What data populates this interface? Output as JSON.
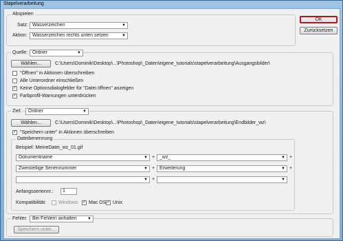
{
  "window": {
    "title": "Stapelverarbeitung"
  },
  "buttons": {
    "ok": "OK",
    "reset": "Zurücksetzen"
  },
  "abspielen": {
    "legend": "Abspielen",
    "satz_label": "Satz:",
    "satz_value": "Wasserzeichen",
    "aktion_label": "Aktion:",
    "aktion_value": "Wasserzeichen rechts unten setzen"
  },
  "quelle": {
    "label": "Quelle:",
    "value": "Ordner",
    "choose": "Wählen...",
    "path": "C:\\Users\\Dominik\\Desktop\\...\\Photoshop\\_Daten\\eigene_tutorials\\stapelverarbeitung\\Ausgangsbilder\\",
    "options": [
      {
        "label": "\"Öffnen\" in Aktionen überschreiben",
        "checked": false
      },
      {
        "label": "Alle Unterordner einschließen",
        "checked": false
      },
      {
        "label": "Keine Optionsdialogfelder für \"Datei öffnen\" anzeigen",
        "checked": true
      },
      {
        "label": "Farbprofil-Warnungen unterdrücken",
        "checked": true
      }
    ]
  },
  "ziel": {
    "label": "Ziel:",
    "value": "Ordner",
    "choose": "Wählen...",
    "path": "C:\\Users\\Dominik\\Desktop\\...\\Photoshop\\_Daten\\eigene_tutorials\\stapelverarbeitung\\Endbilder_wz\\",
    "override_label": "\"Speichern unter\" in Aktionen überschreiben",
    "override_checked": true,
    "naming": {
      "legend": "Dateibenennung",
      "example": "Beispiel: MeineDatei_wz_01.gif",
      "rows": [
        {
          "left": "Dokumentname",
          "right": "_wz_"
        },
        {
          "left": "Zweistellige Seriennummer",
          "right": "Erweiterung"
        },
        {
          "left": "",
          "right": ""
        }
      ],
      "start_label": "Anfangsseriennr.:",
      "start_value": "1",
      "compat_label": "Kompatibilität:",
      "compat": [
        {
          "label": "Windows",
          "checked": false,
          "disabled": true
        },
        {
          "label": "Mac OS",
          "checked": true,
          "disabled": false
        },
        {
          "label": "Unix",
          "checked": true,
          "disabled": false
        }
      ]
    }
  },
  "fehler": {
    "label": "Fehler:",
    "value": "Bei Fehlern anhalten",
    "save_as": "Speichern unter..."
  }
}
